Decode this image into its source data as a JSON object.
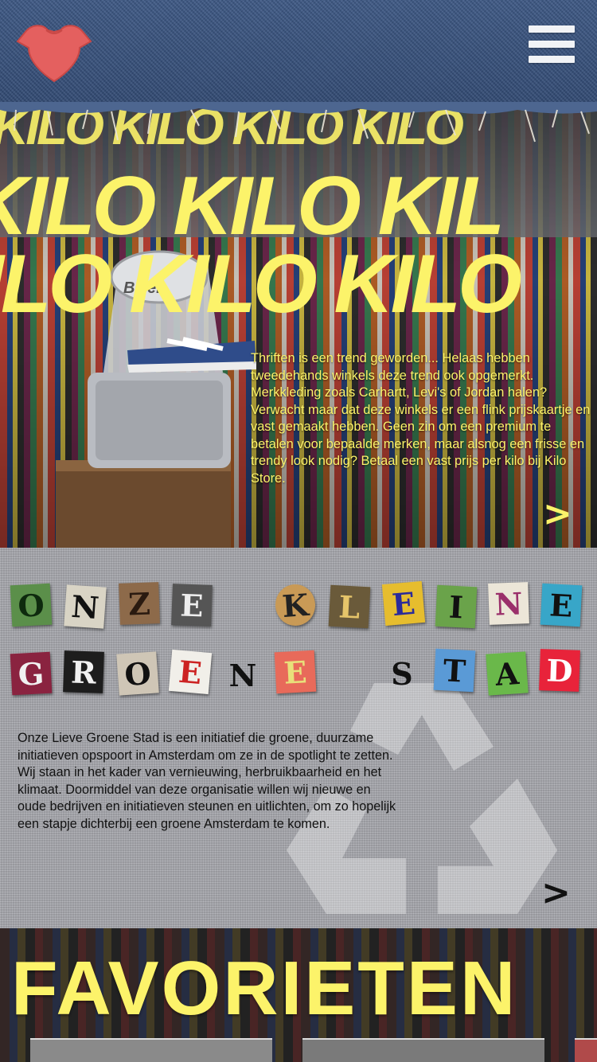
{
  "header": {
    "logo_icon": "heart-tshirt-icon",
    "menu_icon": "hamburger-menu-icon"
  },
  "hero": {
    "kilo_word": "KILO",
    "kilo_row1": "KILO KILO KILO KILO",
    "kilo_row2": "KILO KILO KIL",
    "kilo_row3": "ILO KILO KILO",
    "description": "Thriften is een trend geworden... Helaas hebben tweedehands winkels deze trend ook opgemerkt. Merkkleding zoals Carhartt, Levi's of Jordan halen? Verwacht maar dat deze winkels er een flink prijskaartje en vast gemaakt hebben. Geen zin om een premium te betalen voor bepaalde merken, maar alsnog een frisse en trendy look nodig? Betaal een vast prijs per kilo bij Kilo Store.",
    "next_arrow": ">",
    "scale_brand": "Bizer"
  },
  "section2": {
    "title_line1": [
      "O",
      "N",
      "Z",
      "E",
      " ",
      "K",
      "L",
      "E",
      "I",
      "N",
      "E"
    ],
    "title_line2": [
      "G",
      "R",
      "O",
      "E",
      "N",
      "E",
      " ",
      "S",
      "T",
      "A",
      "D"
    ],
    "description": "Onze Lieve Groene Stad is een initiatief die groene, duurzame initiatieven opspoort in Amsterdam om ze in de spotlight te zetten. Wij staan in het kader van vernieuwing, herbruikbaarheid en het klimaat. Doormiddel van deze organisatie willen wij nieuwe en oude bedrijven en initiatieven steunen en uitlichten, om zo hopelijk een stapje dichterbij een groene Amsterdam te komen.",
    "next_arrow": ">",
    "background_icon": "recycle-icon"
  },
  "section3": {
    "title": "FAVORIETEN"
  },
  "colors": {
    "accent_yellow": "#fcf36a",
    "denim": "#35507a",
    "logo_red": "#e4605f"
  }
}
